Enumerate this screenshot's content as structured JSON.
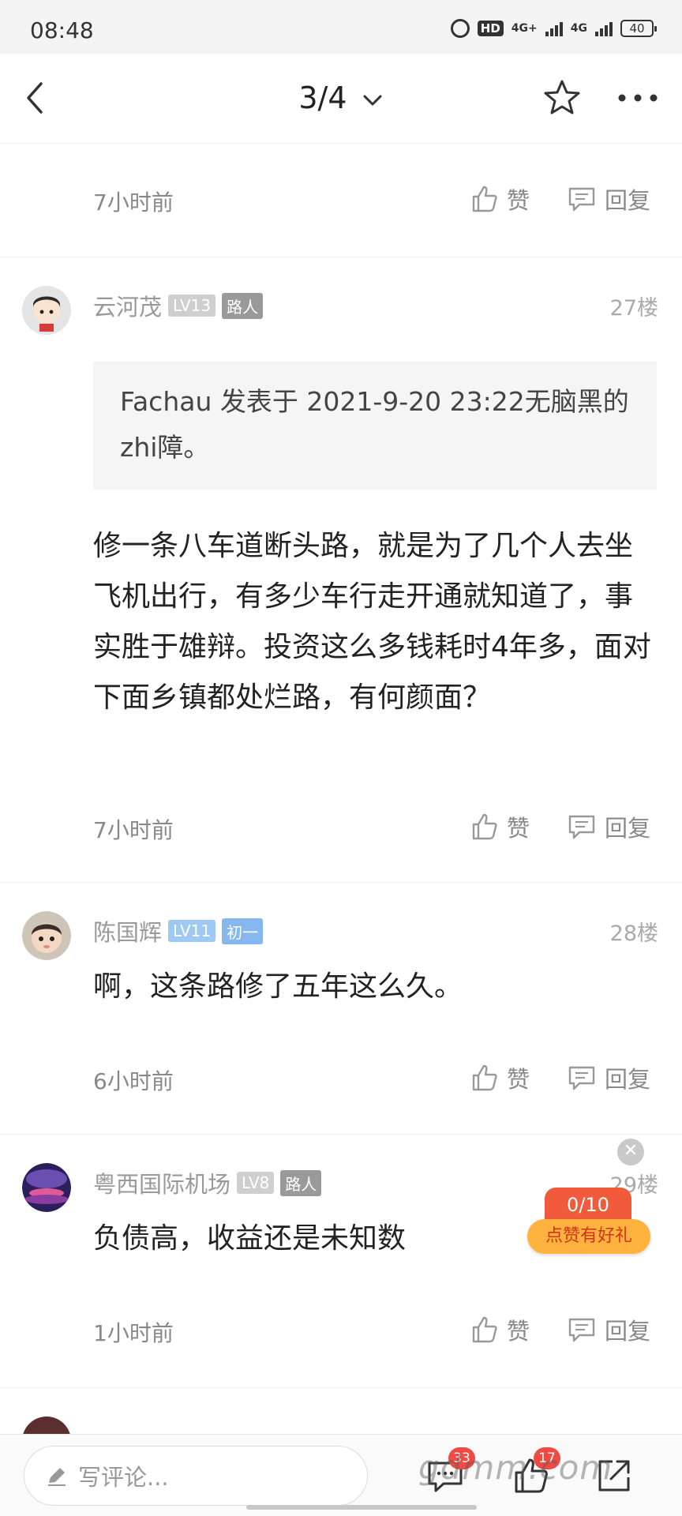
{
  "status_bar": {
    "time": "08:48",
    "hd_label": "HD",
    "net1": "4G+",
    "net2": "4G",
    "battery": "40"
  },
  "header": {
    "page_indicator": "3/4",
    "icons": [
      "back-arrow-icon",
      "chevron-down-icon",
      "star-icon",
      "more-icon"
    ]
  },
  "actions": {
    "like_label": "赞",
    "reply_label": "回复"
  },
  "comments": [
    {
      "time": "7小时前",
      "partial": true
    },
    {
      "author": "云河茂",
      "level": "LV13",
      "role": "路人",
      "floor": "27楼",
      "quote": "Fachau 发表于 2021-9-20 23:22无脑黑的zhi障。",
      "body": "修一条八车道断头路，就是为了几个人去坐飞机出行，有多少车行走开通就知道了，事实胜于雄辩。投资这么多钱耗时4年多，面对下面乡镇都处烂路，有何颜面？",
      "time": "7小时前"
    },
    {
      "author": "陈国辉",
      "level": "LV11",
      "role": "初一",
      "floor": "28楼",
      "body": "啊，这条路修了五年这么久。",
      "time": "6小时前"
    },
    {
      "author": "粤西国际机场",
      "level": "LV8",
      "role": "路人",
      "floor": "29楼",
      "body": "负债高，收益还是未知数",
      "time": "1小时前"
    }
  ],
  "promo": {
    "count": "0/10",
    "label": "点赞有好礼"
  },
  "bottom_bar": {
    "write_placeholder": "写评论...",
    "comment_badge": "33",
    "like_badge": "17",
    "watermark": "gdmm.com"
  },
  "colors": {
    "badge_red": "#f04a44",
    "promo_orange": "#ffb23e",
    "promo_red": "#f15a3b",
    "level_blue": "#9ec9f2"
  }
}
